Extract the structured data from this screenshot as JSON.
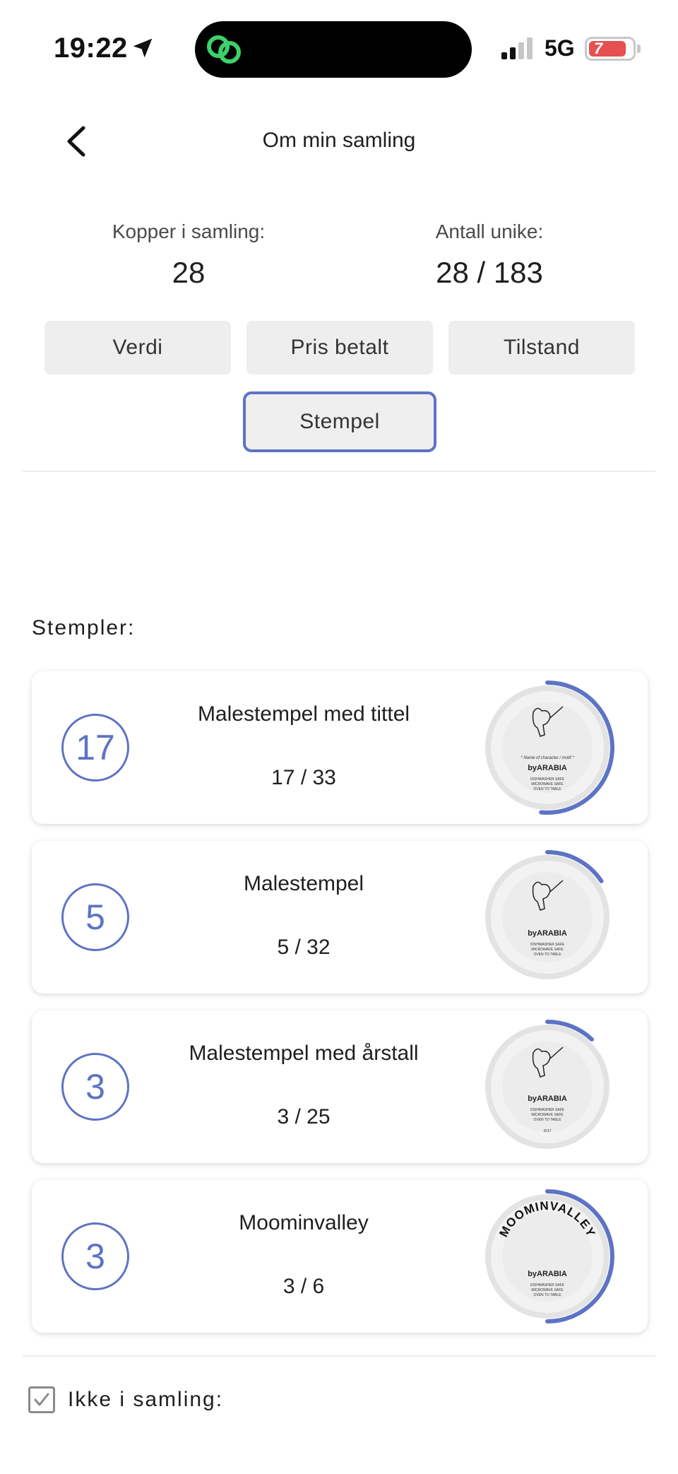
{
  "status_bar": {
    "time": "19:22",
    "network": "5G",
    "battery": "7"
  },
  "header": {
    "title": "Om min samling",
    "back_icon": "chevron-left-icon"
  },
  "stats": {
    "collection_label": "Kopper i samling:",
    "collection_value": "28",
    "unique_label": "Antall unike:",
    "unique_value": "28 / 183"
  },
  "filters": {
    "value_label": "Verdi",
    "price_label": "Pris betalt",
    "condition_label": "Tilstand",
    "stamp_label": "Stempel",
    "active": "Stempel"
  },
  "stamps": {
    "title": "Stempler:",
    "items": [
      {
        "count": "17",
        "title": "Malestempel med tittel",
        "progress_text": "17 / 33",
        "owned": 17,
        "total": 33
      },
      {
        "count": "5",
        "title": "Malestempel",
        "progress_text": "5 / 32",
        "owned": 5,
        "total": 32
      },
      {
        "count": "3",
        "title": "Malestempel med årstall",
        "progress_text": "3 / 25",
        "owned": 3,
        "total": 25
      },
      {
        "count": "3",
        "title": "Moominvalley",
        "progress_text": "3 / 6",
        "owned": 3,
        "total": 6
      }
    ]
  },
  "stamp_images": {
    "brand": "byARABIA",
    "care_line1": "DISHWASHER SAFE",
    "care_line2": "MICROWAVE SAFE",
    "care_line3": "OVEN TO TABLE",
    "character_line": "* Name of character / motif *",
    "year": "2017",
    "valley_text": "MOOMINVALLEY"
  },
  "not_in_collection": {
    "label": "Ikke i samling:",
    "checked": true
  },
  "colors": {
    "accent": "#5d73c4",
    "button_bg": "#eeeeee"
  }
}
